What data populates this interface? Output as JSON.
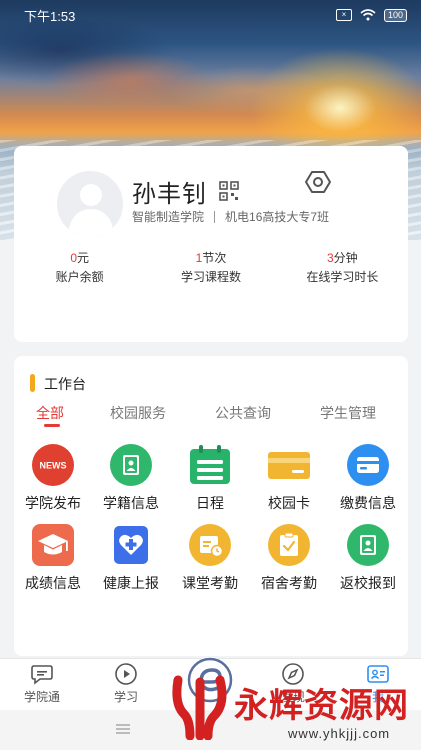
{
  "status_bar": {
    "time": "下午1:53",
    "battery": "100"
  },
  "profile": {
    "name": "孙丰钊",
    "college": "智能制造学院",
    "class_name": "机电16高技大专7班"
  },
  "stats": [
    {
      "value": "0",
      "unit": "元",
      "label": "账户余额"
    },
    {
      "value": "1",
      "unit": "节次",
      "label": "学习课程数"
    },
    {
      "value": "3",
      "unit": "分钟",
      "label": "在线学习时长"
    }
  ],
  "workbench": {
    "title": "工作台",
    "tabs": [
      "全部",
      "校园服务",
      "公共查询",
      "学生管理"
    ],
    "active_tab": "全部",
    "apps": [
      {
        "label": "学院发布",
        "icon": "news-icon",
        "badge": "NEWS",
        "color": "#e0402f"
      },
      {
        "label": "学籍信息",
        "icon": "student-record-icon",
        "color": "#2fb86b"
      },
      {
        "label": "日程",
        "icon": "calendar-icon",
        "color": "#27b46a"
      },
      {
        "label": "校园卡",
        "icon": "campus-card-icon",
        "color": "#f2b531"
      },
      {
        "label": "缴费信息",
        "icon": "payment-card-icon",
        "color": "#2d8ff0"
      },
      {
        "label": "成绩信息",
        "icon": "graduation-cap-icon",
        "color": "#ee6a4d"
      },
      {
        "label": "健康上报",
        "icon": "health-report-icon",
        "color": "#3d6fe8"
      },
      {
        "label": "课堂考勤",
        "icon": "class-attendance-icon",
        "color": "#f2b531"
      },
      {
        "label": "宿舍考勤",
        "icon": "dorm-attendance-icon",
        "color": "#f2b531"
      },
      {
        "label": "返校报到",
        "icon": "return-report-icon",
        "color": "#2fb86b"
      }
    ]
  },
  "bottom_nav": [
    {
      "label": "学院通",
      "icon": "chat-bubble-icon"
    },
    {
      "label": "学习",
      "icon": "play-circle-icon"
    },
    {
      "label": "",
      "icon": "center-logo-icon"
    },
    {
      "label": "发现",
      "icon": "compass-icon"
    },
    {
      "label": "我",
      "icon": "profile-card-icon"
    }
  ],
  "watermark": {
    "brand": "永辉资源网",
    "url": "www.yhkjjj.com"
  },
  "colors": {
    "accent": "#e53935",
    "title_bar": "#f0a81e",
    "watermark": "#d32121"
  }
}
